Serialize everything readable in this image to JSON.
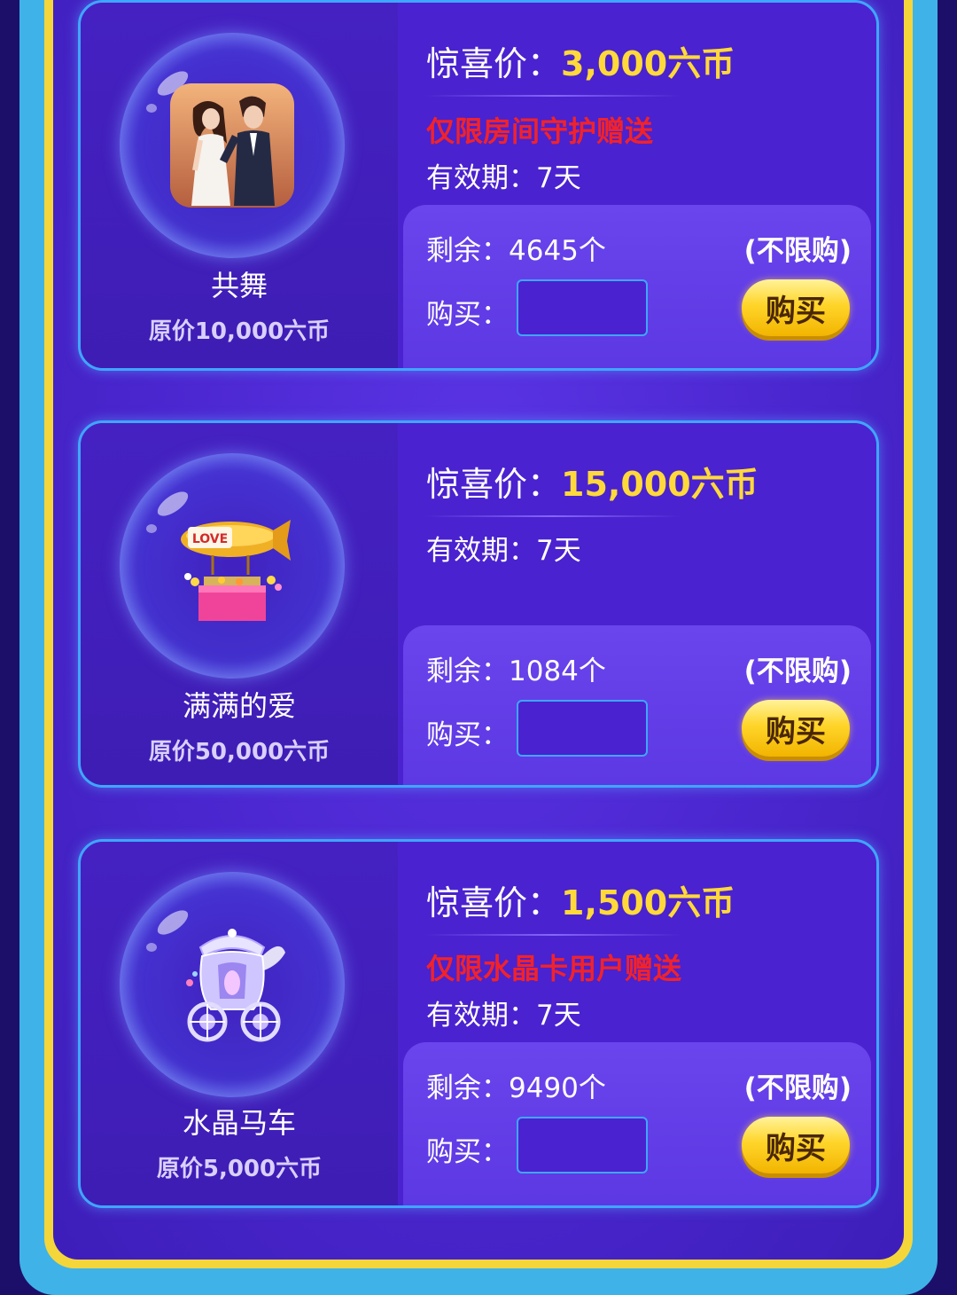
{
  "labels": {
    "surprise_price": "惊喜价：",
    "validity": "有效期：",
    "remaining": "剩余：",
    "buy": "购买：",
    "limit": "(不限购)",
    "buy_button": "购买"
  },
  "gifts": [
    {
      "name": "共舞",
      "original_price": "原价10,000六币",
      "surprise_price": "3,000六币",
      "restriction": "仅限房间守护赠送",
      "validity": "7天",
      "remaining": "4645个",
      "quantity": "",
      "icon": "dancing-couple-icon"
    },
    {
      "name": "满满的爱",
      "original_price": "原价50,000六币",
      "surprise_price": "15,000六币",
      "restriction": "",
      "validity": "7天",
      "remaining": "1084个",
      "quantity": "",
      "icon": "love-airship-icon"
    },
    {
      "name": "水晶马车",
      "original_price": "原价5,000六币",
      "surprise_price": "1,500六币",
      "restriction": "仅限水晶卡用户赠送",
      "validity": "7天",
      "remaining": "9490个",
      "quantity": "",
      "icon": "crystal-carriage-icon"
    }
  ],
  "colors": {
    "accent_yellow": "#ffd93a",
    "restriction_red": "#f2222a",
    "card_border": "#3fa6ff",
    "panel_purple": "#4a22cf",
    "outer_blue": "#3fb3e8",
    "frame_yellow": "#f4d63a"
  }
}
